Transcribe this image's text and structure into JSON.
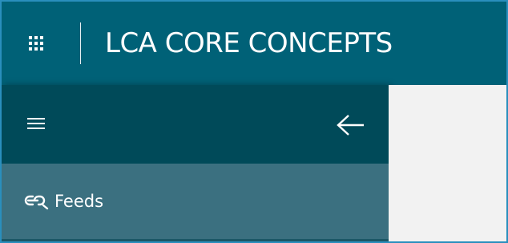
{
  "header": {
    "title": "LCA CORE CONCEPTS",
    "app_launcher_icon": "waffle-grid-icon"
  },
  "sidebar": {
    "menu_icon": "hamburger-menu-icon",
    "collapse_icon": "arrow-left-icon",
    "items": [
      {
        "label": "Feeds",
        "icon": "feeds-link-icon"
      }
    ]
  },
  "colors": {
    "topbar": "#006177",
    "sidebar_header": "#004a59",
    "sidebar_item": "#3b7080",
    "content_bg": "#f2f2f2",
    "frame_border": "#2a8fbd",
    "text": "#ffffff"
  }
}
